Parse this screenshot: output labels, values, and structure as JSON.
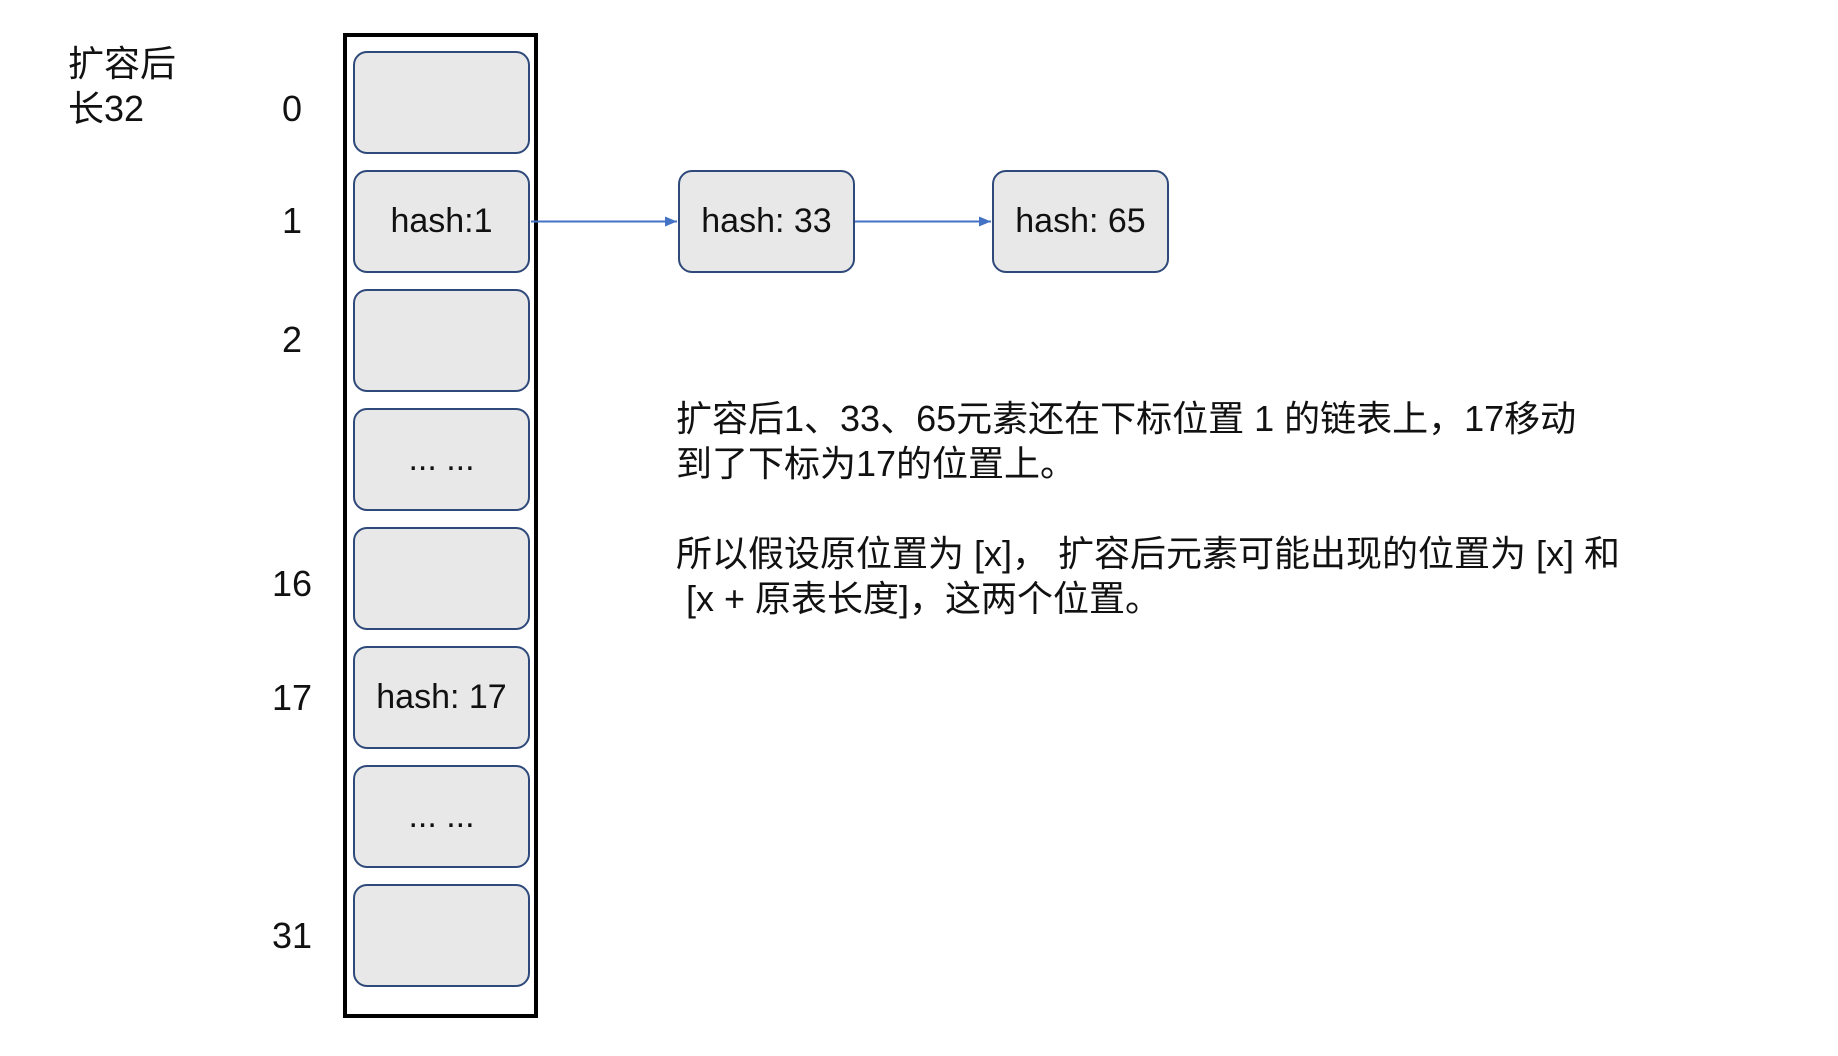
{
  "header_label": {
    "line1": "扩容后",
    "line2": "长32"
  },
  "table": {
    "slots": [
      {
        "index": "0"
      },
      {
        "index": "1",
        "content": "hash:1"
      },
      {
        "index": "2"
      },
      {
        "content": "... ..."
      },
      {
        "index": "16"
      },
      {
        "index": "17",
        "content": "hash: 17"
      },
      {
        "content": "... ..."
      },
      {
        "index": "31"
      }
    ]
  },
  "chain": {
    "nodes": [
      "hash: 33",
      "hash: 65"
    ]
  },
  "notes": {
    "paragraph1": [
      "扩容后1、33、65元素还在下标位置 1 的链表上，17移动",
      "到了下标为17的位置上。"
    ],
    "paragraph2": [
      "所以假设原位置为 [x]， 扩容后元素可能出现的位置为 [x] 和",
      " [x + 原表长度]，这两个位置。"
    ]
  },
  "colors": {
    "cell_fill": "#e8e8e8",
    "cell_border": "#2f4a7a",
    "arrow": "#4472c4",
    "table_border": "#000000",
    "text": "#111111"
  }
}
